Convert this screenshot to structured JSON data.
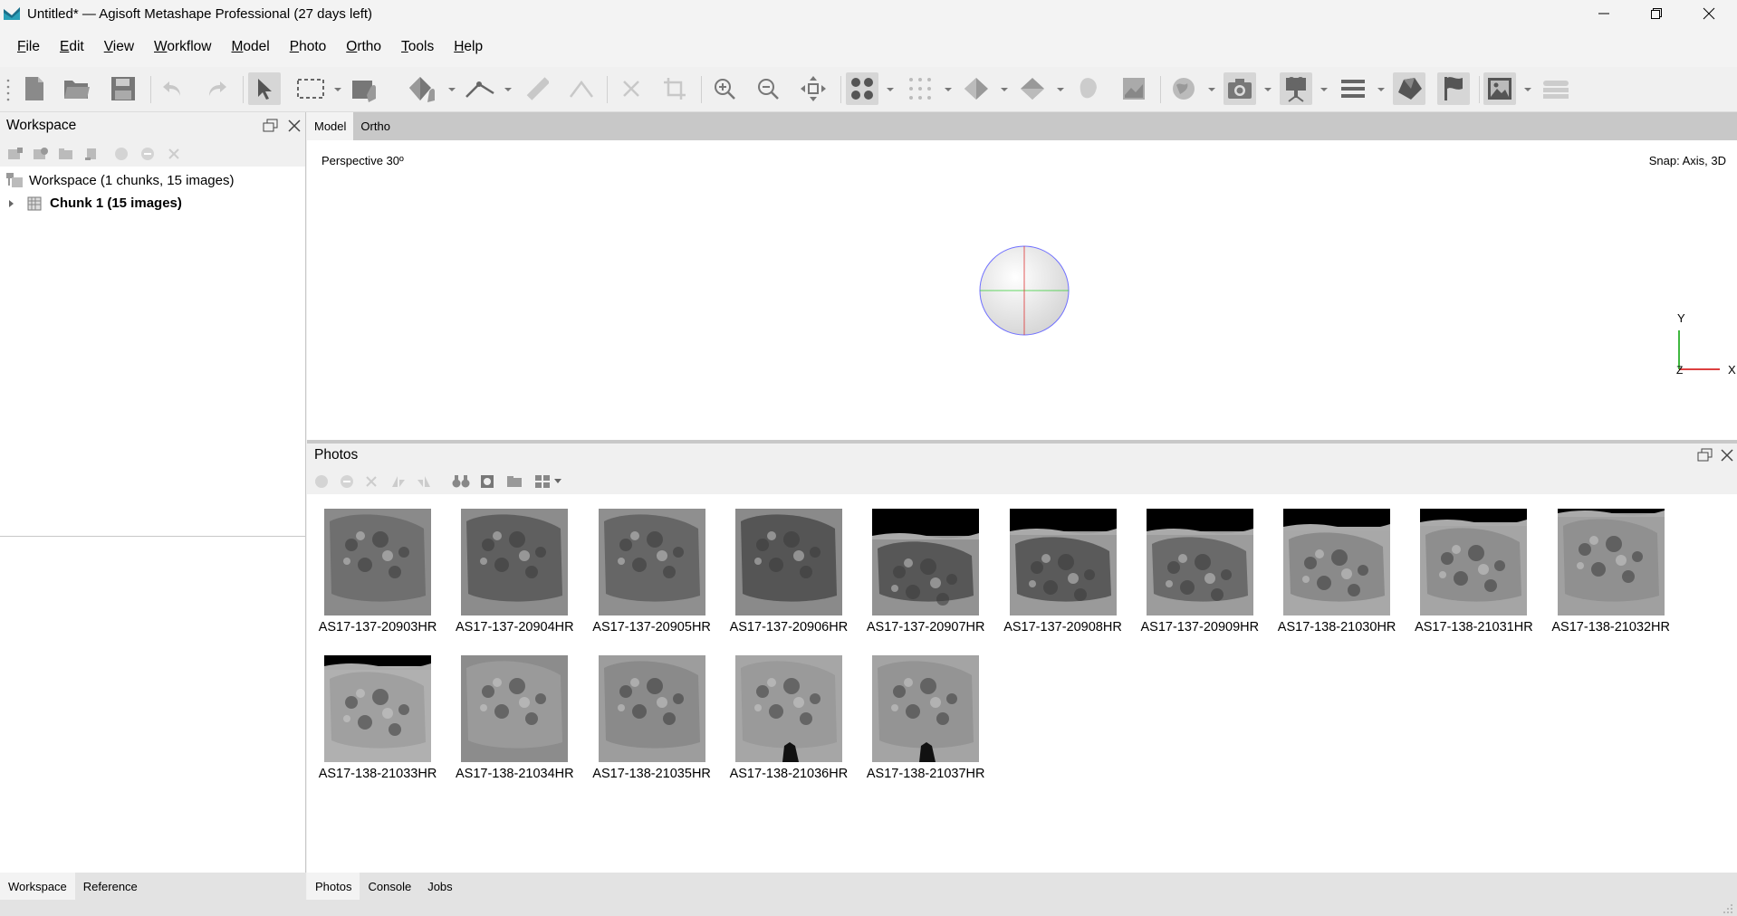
{
  "window": {
    "title": "Untitled* — Agisoft Metashape Professional (27 days left)"
  },
  "menu": [
    {
      "label": "File",
      "u": "F",
      "rest": "ile"
    },
    {
      "label": "Edit",
      "u": "E",
      "rest": "dit"
    },
    {
      "label": "View",
      "u": "V",
      "rest": "iew"
    },
    {
      "label": "Workflow",
      "u": "W",
      "rest": "orkflow"
    },
    {
      "label": "Model",
      "u": "M",
      "rest": "odel"
    },
    {
      "label": "Photo",
      "u": "P",
      "rest": "hoto"
    },
    {
      "label": "Ortho",
      "u": "O",
      "rest": "rtho"
    },
    {
      "label": "Tools",
      "u": "T",
      "rest": "ools"
    },
    {
      "label": "Help",
      "u": "H",
      "rest": "elp"
    }
  ],
  "workspace": {
    "title": "Workspace",
    "root_label": "Workspace (1 chunks, 15 images)",
    "chunk_label": "Chunk 1 (15 images)"
  },
  "view_tabs": {
    "model": "Model",
    "ortho": "Ortho"
  },
  "viewport": {
    "projection": "Perspective 30º",
    "snap": "Snap: Axis, 3D",
    "axis_y": "Y",
    "axis_x": "X",
    "axis_z": "Z"
  },
  "photos": {
    "title": "Photos",
    "items": [
      "AS17-137-20903HR",
      "AS17-137-20904HR",
      "AS17-137-20905HR",
      "AS17-137-20906HR",
      "AS17-137-20907HR",
      "AS17-137-20908HR",
      "AS17-137-20909HR",
      "AS17-138-21030HR",
      "AS17-138-21031HR",
      "AS17-138-21032HR",
      "AS17-138-21033HR",
      "AS17-138-21034HR",
      "AS17-138-21035HR",
      "AS17-138-21036HR",
      "AS17-138-21037HR"
    ]
  },
  "bottom_tabs_left": {
    "workspace": "Workspace",
    "reference": "Reference"
  },
  "bottom_tabs_right": {
    "photos": "Photos",
    "console": "Console",
    "jobs": "Jobs"
  },
  "icons": {
    "toolbar": [
      "new-icon",
      "open-icon",
      "save-icon",
      "undo-icon",
      "redo-icon",
      "navigation-icon",
      "rectangle-selection-icon",
      "draw-shape-icon",
      "ruler-icon",
      "remove-icon",
      "crop-icon",
      "zoom-in-icon",
      "zoom-out-icon",
      "move-icon",
      "point-cloud-icon",
      "tiled-model-icon",
      "shaded-model-icon",
      "orthomosaic-icon",
      "show-cameras-icon",
      "show-markers-icon",
      "show-images-icon"
    ]
  },
  "colors": {
    "accent_axis_x": "#d00000",
    "accent_axis_y": "#00a000",
    "trackball_ring": "#6060ff"
  }
}
